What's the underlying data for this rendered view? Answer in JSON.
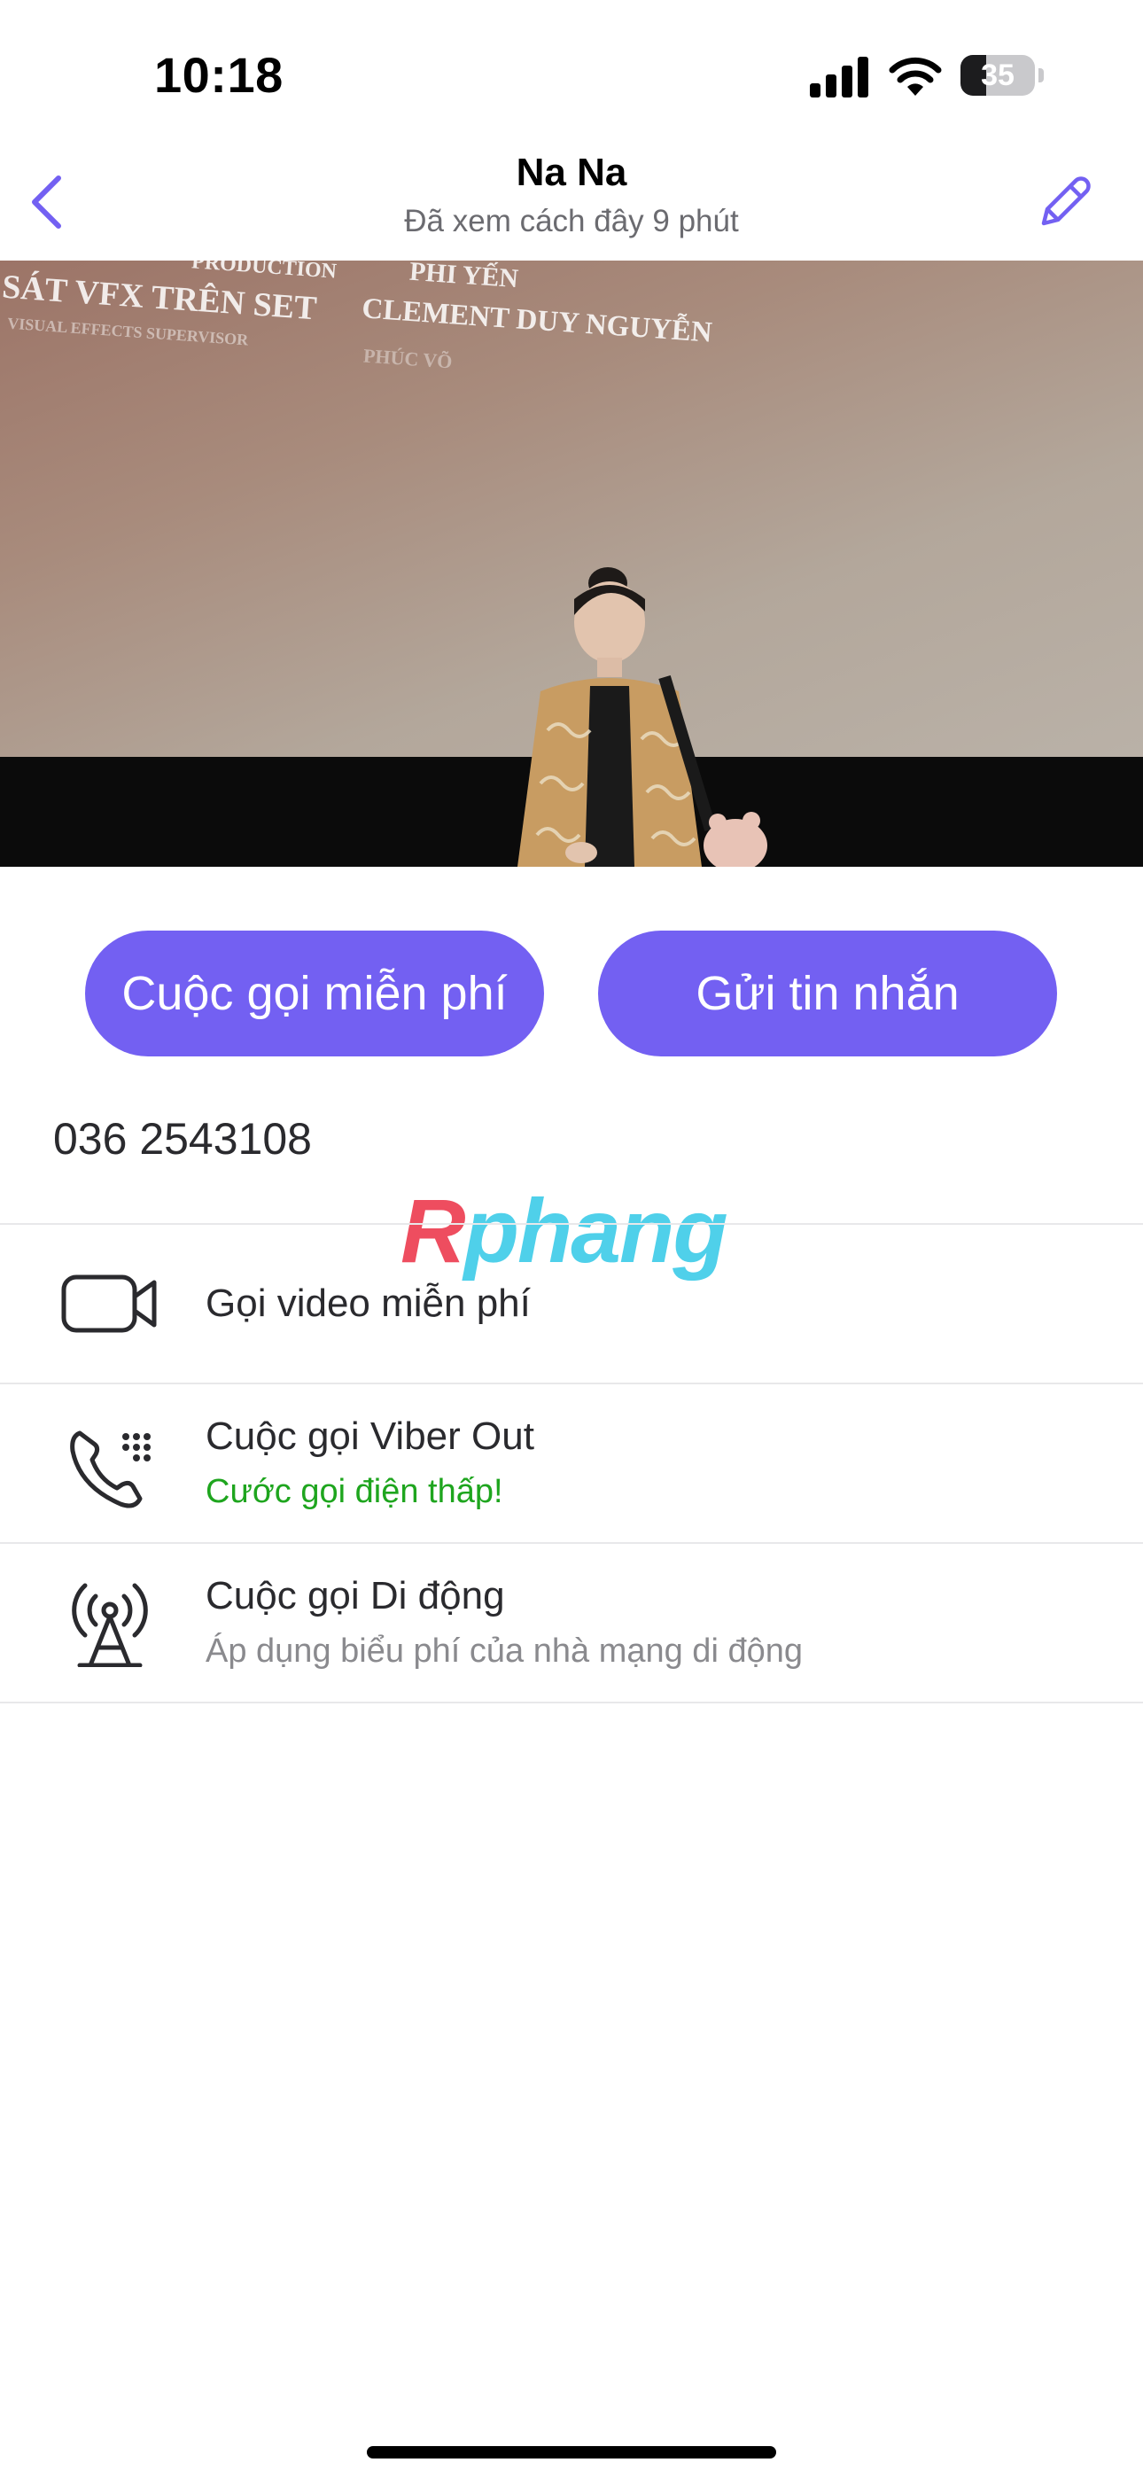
{
  "status_bar": {
    "time": "10:18",
    "battery_level": "35",
    "battery_percent": 35
  },
  "header": {
    "contact_name": "Na Na",
    "last_seen": "Đã xem cách đây 9 phút",
    "back_icon": "chevron-left-icon",
    "edit_icon": "pencil-icon"
  },
  "cover_photo": {
    "credits": [
      "SÁT VFX TRÊN SET",
      "VISUAL EFFECTS SUPERVISOR",
      "CLEMENT DUY NGUYỄN",
      "PRODUCTION",
      "PHI YẾN",
      "PHÚC VÕ"
    ]
  },
  "actions": {
    "free_call": "Cuộc gọi miễn phí",
    "send_message": "Gửi tin nhắn"
  },
  "phone_number": "036 2543108",
  "watermark": {
    "first_letter": "R",
    "rest": "phang"
  },
  "options": [
    {
      "title": "Gọi video miễn phí",
      "subtitle": "",
      "icon": "video-camera-icon"
    },
    {
      "title": "Cuộc gọi Viber Out",
      "subtitle": "Cước gọi điện thấp!",
      "icon": "phone-keypad-icon"
    },
    {
      "title": "Cuộc gọi Di động",
      "subtitle": "Áp dụng biểu phí của nhà mạng di động",
      "icon": "cell-tower-icon"
    }
  ],
  "colors": {
    "accent": "#7360f2",
    "green_subtitle": "#1ea51e",
    "gray_subtitle": "#8a8a8e"
  }
}
